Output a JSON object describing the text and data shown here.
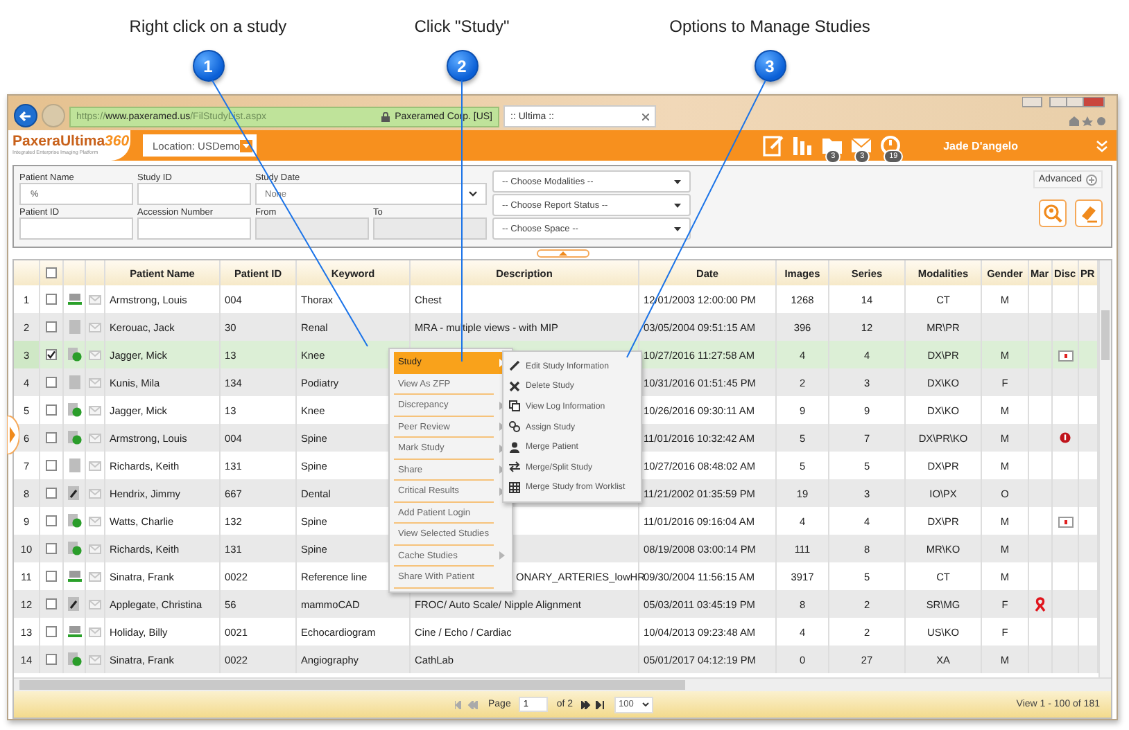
{
  "callouts": [
    {
      "number": "1",
      "label": "Right click on a study"
    },
    {
      "number": "2",
      "label": "Click \"Study\""
    },
    {
      "number": "3",
      "label": "Options to Manage Studies"
    }
  ],
  "browser": {
    "url_scheme": "https://",
    "url_host": "www.paxeramed.us",
    "url_path": "/FilStudyList.aspx",
    "site_identity": "Paxeramed Corp. [US]",
    "tab_title": ":: Ultima ::"
  },
  "header": {
    "logo": "PaxeraUltima",
    "logo_number": "360",
    "logo_tagline": "Integrated Enterprise Imaging Platform",
    "location": "Location: USDemo",
    "icons": [
      {
        "kind": "notes"
      },
      {
        "kind": "chart"
      },
      {
        "kind": "folder",
        "badge": "3"
      },
      {
        "kind": "mail",
        "badge": "3"
      },
      {
        "kind": "alarm",
        "badge": "19"
      }
    ],
    "user": "Jade D'angelo"
  },
  "search": {
    "patient_name": {
      "label": "Patient Name",
      "value": "%"
    },
    "study_id": {
      "label": "Study ID"
    },
    "study_date": {
      "label": "Study Date",
      "value": "None"
    },
    "patient_id": {
      "label": "Patient ID"
    },
    "accession_number": {
      "label": "Accession Number"
    },
    "from": {
      "label": "From",
      "disabled": true
    },
    "to": {
      "label": "To",
      "disabled": true
    },
    "dropdowns": [
      "-- Choose Modalities --",
      "-- Choose Report Status --",
      "-- Choose Space --"
    ],
    "advanced": "Advanced"
  },
  "table": {
    "select_all_checked": false,
    "columns": [
      "Patient Name",
      "Patient ID",
      "Keyword",
      "Description",
      "Date",
      "Images",
      "Series",
      "Modalities",
      "Gender",
      "Mar",
      "Disc",
      "PR"
    ],
    "rows": [
      {
        "number": "1",
        "checked": false,
        "selected": false,
        "status": {
          "kind": "sent"
        },
        "name": "Armstrong, Louis",
        "patient_id": "004",
        "keyword": "Thorax",
        "description": "Chest",
        "date": "12/01/2003 12:00:00 PM",
        "images": "1268",
        "series": "14",
        "modalities": "CT",
        "gender": "M"
      },
      {
        "number": "2",
        "checked": false,
        "selected": false,
        "status": {
          "kind": "plain"
        },
        "name": "Kerouac, Jack",
        "patient_id": "30",
        "keyword": "Renal",
        "description": "MRA - multiple views - with MIP",
        "date": "03/05/2004 09:51:15 AM",
        "images": "396",
        "series": "12",
        "modalities": "MR\\PR"
      },
      {
        "number": "3",
        "checked": true,
        "selected": true,
        "status": {
          "kind": "done"
        },
        "name": "Jagger, Mick",
        "patient_id": "13",
        "keyword": "Knee",
        "date": "10/27/2016 11:27:58 AM",
        "images": "4",
        "series": "4",
        "modalities": "DX\\PR",
        "gender": "M",
        "disc": {
          "kind": "kit"
        }
      },
      {
        "number": "4",
        "checked": false,
        "selected": false,
        "status": {
          "kind": "plain"
        },
        "name": "Kunis, Mila",
        "patient_id": "134",
        "keyword": "Podiatry",
        "date": "10/31/2016 01:51:45 PM",
        "images": "2",
        "series": "3",
        "modalities": "DX\\KO",
        "gender": "F"
      },
      {
        "number": "5",
        "checked": false,
        "selected": false,
        "status": {
          "kind": "done"
        },
        "name": "Jagger, Mick",
        "patient_id": "13",
        "keyword": "Knee",
        "date": "10/26/2016 09:30:11 AM",
        "images": "9",
        "series": "9",
        "modalities": "DX\\KO",
        "gender": "M"
      },
      {
        "number": "6",
        "checked": false,
        "selected": false,
        "status": {
          "kind": "done"
        },
        "name": "Armstrong, Louis",
        "patient_id": "004",
        "keyword": "Spine",
        "date": "11/01/2016 10:32:42 AM",
        "images": "5",
        "series": "7",
        "modalities": "DX\\PR\\KO",
        "gender": "M",
        "disc": {
          "kind": "alert"
        }
      },
      {
        "number": "7",
        "checked": false,
        "selected": false,
        "status": {
          "kind": "plain"
        },
        "name": "Richards, Keith",
        "patient_id": "131",
        "keyword": "Spine",
        "date": "10/27/2016 08:48:02 AM",
        "images": "5",
        "series": "5",
        "modalities": "DX\\PR",
        "gender": "M"
      },
      {
        "number": "8",
        "checked": false,
        "selected": false,
        "status": {
          "kind": "edit"
        },
        "name": "Hendrix, Jimmy",
        "patient_id": "667",
        "keyword": "Dental",
        "date": "11/21/2002 01:35:59 PM",
        "images": "19",
        "series": "3",
        "modalities": "IO\\PX",
        "gender": "O"
      },
      {
        "number": "9",
        "checked": false,
        "selected": false,
        "status": {
          "kind": "done"
        },
        "name": "Watts, Charlie",
        "patient_id": "132",
        "keyword": "Spine",
        "date": "11/01/2016 09:16:04 AM",
        "images": "4",
        "series": "4",
        "modalities": "DX\\PR",
        "gender": "M",
        "disc": {
          "kind": "kit"
        }
      },
      {
        "number": "10",
        "checked": false,
        "selected": false,
        "status": {
          "kind": "done"
        },
        "name": "Richards, Keith",
        "patient_id": "131",
        "keyword": "Spine",
        "date": "08/19/2008 03:00:14 PM",
        "images": "111",
        "series": "8",
        "modalities": "MR\\KO",
        "gender": "M"
      },
      {
        "number": "11",
        "checked": false,
        "selected": false,
        "status": {
          "kind": "sent"
        },
        "name": "Sinatra, Frank",
        "patient_id": "0022",
        "keyword": "Reference line",
        "description": "ONARY_ARTERIES_lowHR",
        "description_partly_hidden": true,
        "date": "09/30/2004 11:56:15 AM",
        "images": "3917",
        "series": "5",
        "modalities": "CT",
        "gender": "M"
      },
      {
        "number": "12",
        "checked": false,
        "selected": false,
        "status": {
          "kind": "edit"
        },
        "name": "Applegate, Christina",
        "patient_id": "56",
        "keyword": "mammoCAD",
        "description": "FROC/ Auto Scale/ Nipple Alignment",
        "date": "05/03/2011 03:45:19 PM",
        "images": "8",
        "series": "2",
        "modalities": "SR\\MG",
        "gender": "F",
        "mark": {
          "kind": "ribbon"
        }
      },
      {
        "number": "13",
        "checked": false,
        "selected": false,
        "status": {
          "kind": "sent"
        },
        "name": "Holiday, Billy",
        "patient_id": "0021",
        "keyword": "Echocardiogram",
        "description": "Cine / Echo / Cardiac",
        "date": "10/04/2013 09:23:48 AM",
        "images": "4",
        "series": "2",
        "modalities": "US\\KO",
        "gender": "F"
      },
      {
        "number": "14",
        "checked": false,
        "selected": false,
        "status": {
          "kind": "done"
        },
        "name": "Sinatra, Frank",
        "patient_id": "0022",
        "keyword": "Angiography",
        "description": "CathLab",
        "date": "05/01/2017 04:12:19 PM",
        "images": "0",
        "series": "27",
        "modalities": "XA",
        "gender": "M"
      }
    ]
  },
  "context_menu": {
    "items": [
      {
        "label": "Study",
        "selected": true,
        "submenu": true
      },
      {
        "label": "View As ZFP",
        "selected": false,
        "submenu": false
      },
      {
        "label": "Discrepancy",
        "selected": false,
        "submenu": true
      },
      {
        "label": "Peer Review",
        "selected": false,
        "submenu": true
      },
      {
        "label": "Mark Study",
        "selected": false,
        "submenu": true
      },
      {
        "label": "Share",
        "selected": false,
        "submenu": true
      },
      {
        "label": "Critical Results",
        "selected": false,
        "submenu": true
      },
      {
        "label": "Add Patient Login",
        "selected": false,
        "submenu": false
      },
      {
        "label": "View Selected Studies",
        "selected": false,
        "submenu": false
      },
      {
        "label": "Cache Studies",
        "selected": false,
        "submenu": true
      },
      {
        "label": "Share With Patient",
        "selected": false,
        "submenu": false
      }
    ]
  },
  "submenu": {
    "items": [
      {
        "kind": "edit",
        "label": "Edit Study Information"
      },
      {
        "kind": "delete",
        "label": "Delete Study"
      },
      {
        "kind": "log",
        "label": "View Log Information"
      },
      {
        "kind": "assign",
        "label": "Assign Study"
      },
      {
        "kind": "merge_patient",
        "label": "Merge Patient"
      },
      {
        "kind": "split",
        "label": "Merge/Split Study"
      },
      {
        "kind": "worklist",
        "label": "Merge Study from Worklist"
      }
    ]
  },
  "pager": {
    "page_label": "Page",
    "page": "1",
    "of": "of 2",
    "page_size": "100",
    "summary": "View 1 - 100 of 181"
  }
}
